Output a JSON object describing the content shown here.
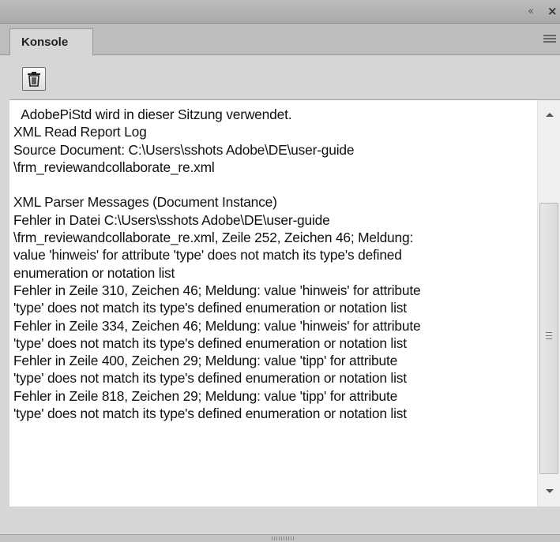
{
  "window": {
    "collapse_icon": "double-chevron-left-icon",
    "close_icon": "close-icon",
    "collapse_glyph": "«",
    "close_glyph": "×"
  },
  "tabs": [
    {
      "label": "Konsole",
      "active": true
    }
  ],
  "toolbar": {
    "clear_icon": "trash-icon"
  },
  "console": {
    "lines": [
      "  AdobePiStd wird in dieser Sitzung verwendet.",
      "XML Read Report Log",
      "Source Document: C:\\Users\\sshots Adobe\\DE\\user-guide",
      "\\frm_reviewandcollaborate_re.xml",
      "",
      "XML Parser Messages (Document Instance)",
      "Fehler in Datei C:\\Users\\sshots Adobe\\DE\\user-guide",
      "\\frm_reviewandcollaborate_re.xml, Zeile 252, Zeichen 46; Meldung:",
      "value 'hinweis' for attribute 'type' does not match its type's defined",
      "enumeration or notation list",
      "Fehler in Zeile 310, Zeichen 46; Meldung: value 'hinweis' for attribute",
      "'type' does not match its type's defined enumeration or notation list",
      "Fehler in Zeile 334, Zeichen 46; Meldung: value 'hinweis' for attribute",
      "'type' does not match its type's defined enumeration or notation list",
      "Fehler in Zeile 400, Zeichen 29; Meldung: value 'tipp' for attribute",
      "'type' does not match its type's defined enumeration or notation list",
      "Fehler in Zeile 818, Zeichen 29; Meldung: value 'tipp' for attribute",
      "'type' does not match its type's defined enumeration or notation list"
    ]
  },
  "scrollbar": {
    "up_icon": "scroll-up-arrow-icon",
    "down_icon": "scroll-down-arrow-icon"
  }
}
